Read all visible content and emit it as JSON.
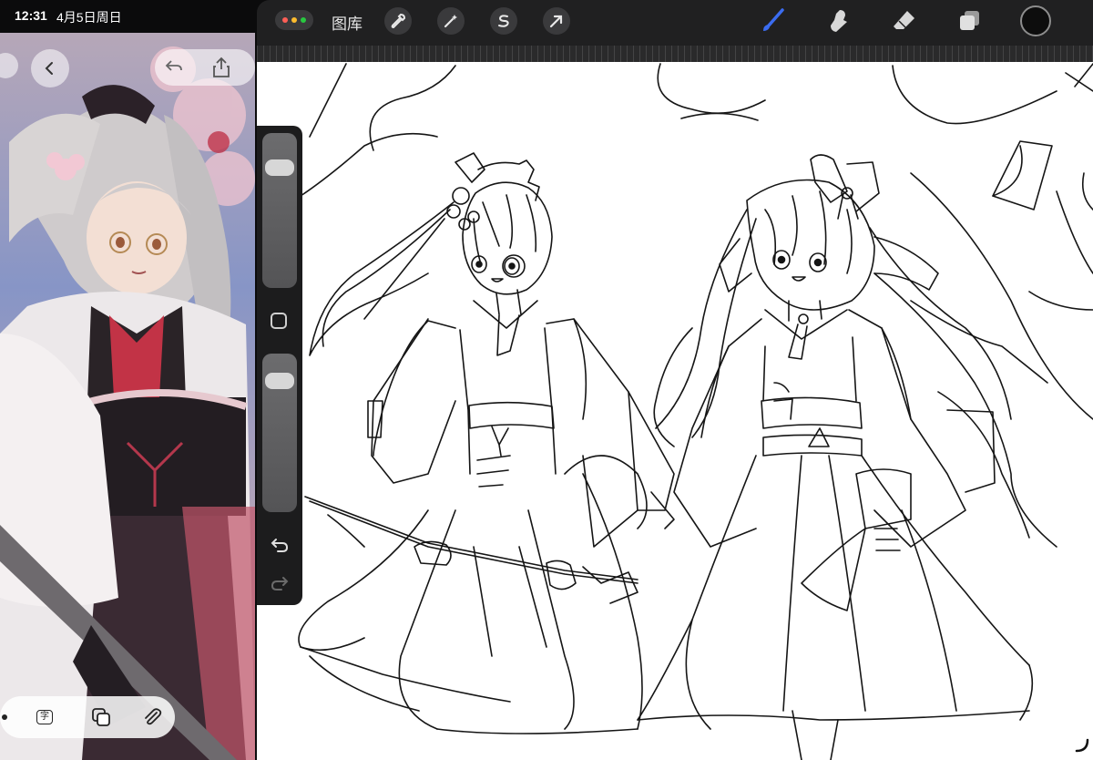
{
  "status_bar": {
    "time": "12:31",
    "date": "4月5日周日"
  },
  "image_viewer": {
    "icons": [
      "back-icon",
      "undo-icon",
      "share-icon",
      "text-recognition-icon",
      "copy-icon",
      "attachment-icon"
    ],
    "text_recognition_label": "字"
  },
  "procreate": {
    "toolbar": {
      "gallery_label": "图库",
      "left_tools": [
        "wrench-icon",
        "magic-wand-icon",
        "selection-icon",
        "transform-arrow-icon"
      ],
      "right_tools": [
        "brush-icon",
        "smudge-icon",
        "eraser-icon",
        "layers-icon",
        "color-icon"
      ],
      "active_tool": "brush-icon",
      "active_color": "#3b6cf0",
      "current_color": "#0d0d0d"
    },
    "side_panel": {
      "brush_size_level": 0.82,
      "opacity_level": 0.88,
      "icons": [
        "modify-square-icon",
        "undo-icon",
        "redo-icon"
      ]
    }
  },
  "colors": {
    "dots": [
      "#ff5f57",
      "#febc2e",
      "#28c840"
    ]
  }
}
